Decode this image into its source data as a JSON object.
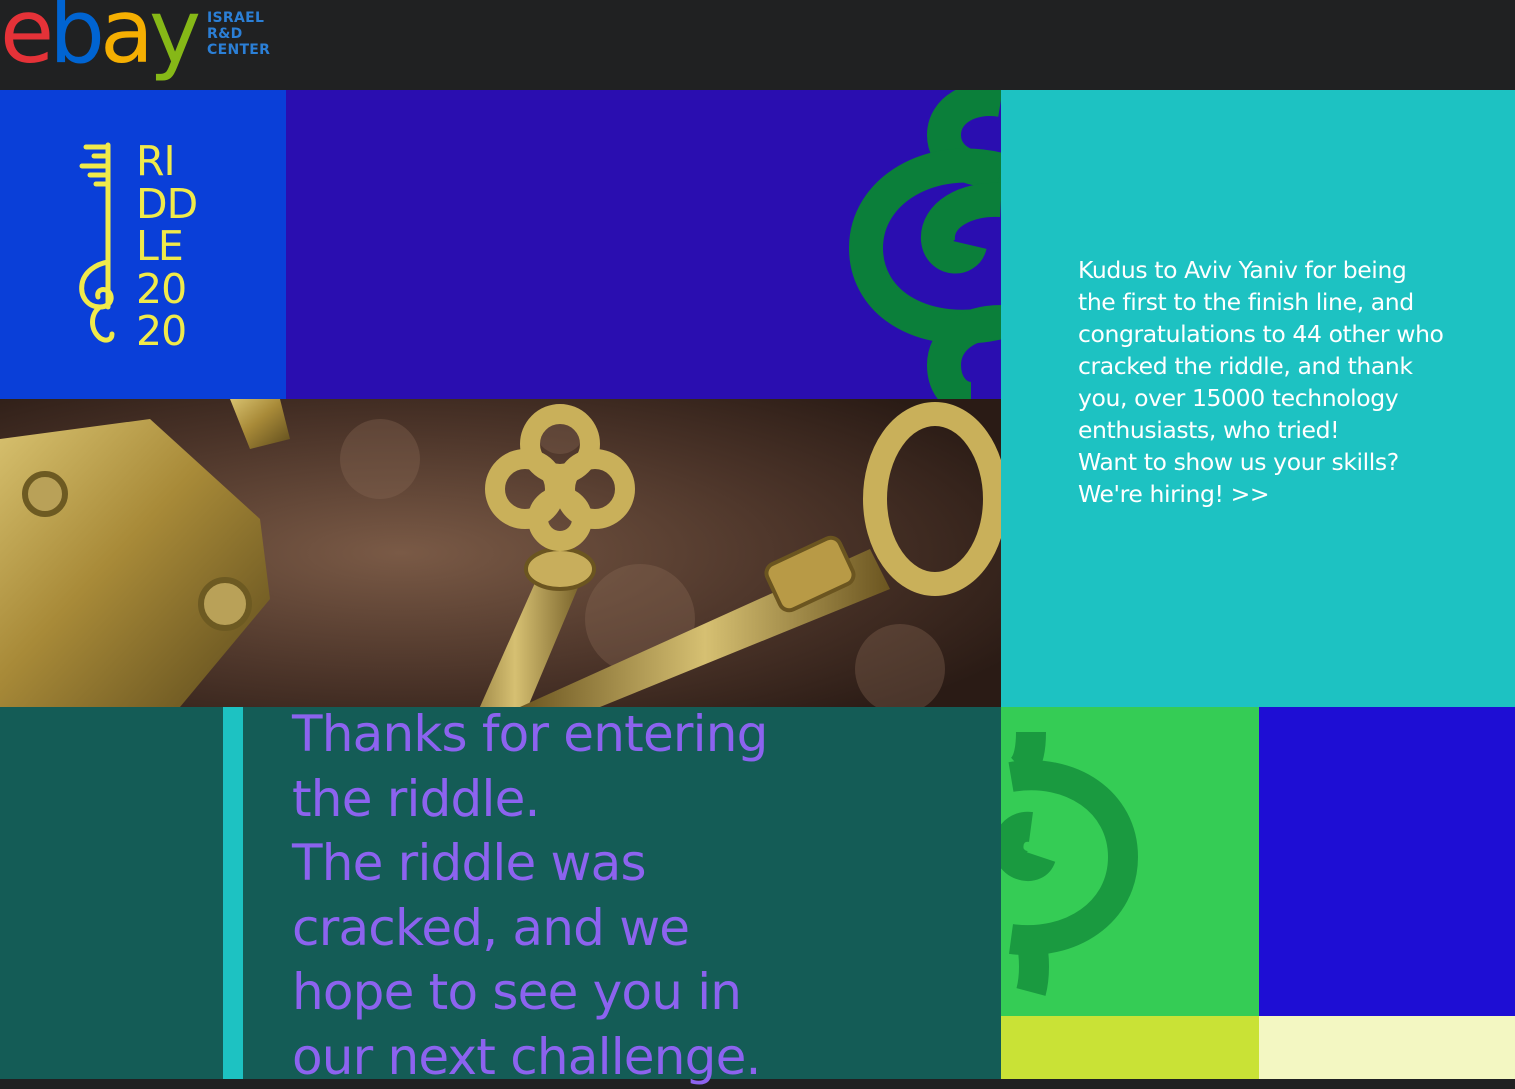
{
  "header": {
    "logo": {
      "letters": [
        "e",
        "b",
        "a",
        "y"
      ],
      "colors": [
        "#e53238",
        "#0064d2",
        "#f5af02",
        "#86b817"
      ]
    },
    "tag_lines": [
      "ISRAEL",
      "R&D",
      "CENTER"
    ],
    "tag_color": "#2b7fd6"
  },
  "riddle_logo": {
    "lines": [
      "RI",
      "DD",
      "LE",
      "20",
      "20"
    ],
    "color": "#f0ea4a",
    "icon": "key-icon"
  },
  "congrats": {
    "message": "Kudus to Aviv Yaniv for being the first to the finish line, and congratulations to 44 other who cracked the riddle, and thank you, over 15000 technology enthusiasts, who tried!",
    "cta": "Want to show us your skills?",
    "hiring_link": "We're hiring! >>"
  },
  "thanks": {
    "line1": "Thanks for entering the riddle.",
    "line2": "The riddle was cracked, and we hope to see you in our next challenge."
  },
  "palette": {
    "royal_blue": "#0a3fd8",
    "purple": "#2a0eb0",
    "teal": "#1dc2c2",
    "dark_teal": "#145c56",
    "green": "#35cc55",
    "ornament_green": "#0b7f3a",
    "blue": "#1e0ed4",
    "lime": "#c9e236",
    "cream": "#f3f7c2",
    "text_purple": "#8c63ef"
  },
  "images": {
    "keys_photo": "antique-brass-keys-photo"
  }
}
